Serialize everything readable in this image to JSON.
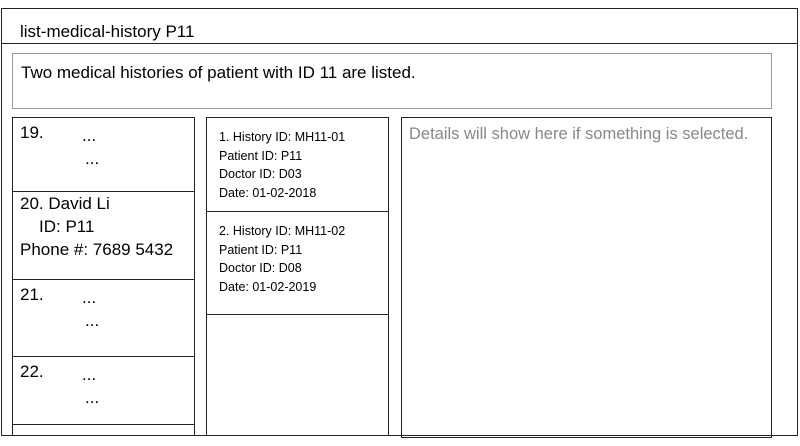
{
  "title": "list-medical-history P11",
  "description": "Two medical histories of patient with ID 11 are listed.",
  "patients": [
    {
      "number": "19.",
      "line1": "...",
      "line2": "..."
    },
    {
      "name_line": "20. David Li",
      "id_line": "ID: P11",
      "phone_line": "Phone #: 7689 5432"
    },
    {
      "number": "21.",
      "line1": "...",
      "line2": "..."
    },
    {
      "number": "22.",
      "line1": "...",
      "line2": "..."
    }
  ],
  "histories": [
    {
      "history_id": "1. History ID: MH11-01",
      "patient_id": "Patient ID: P11",
      "doctor_id": "Doctor ID:  D03",
      "date": "Date: 01-02-2018"
    },
    {
      "history_id": "2. History ID: MH11-02",
      "patient_id": "Patient ID: P11",
      "doctor_id": "Doctor ID:  D08",
      "date": "Date: 01-02-2019"
    }
  ],
  "details_placeholder": "Details will show here if something is selected."
}
